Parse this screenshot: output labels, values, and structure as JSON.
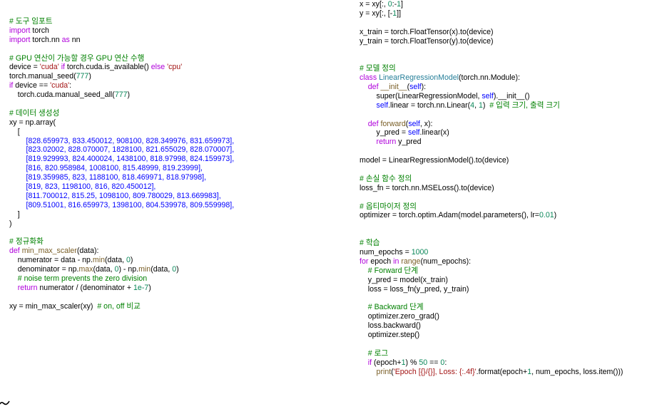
{
  "colors": {
    "keyword": "#af00db",
    "comment": "#008000",
    "string": "#a31515",
    "number": "#098658",
    "function": "#795e26",
    "class": "#267f99",
    "self": "#0000ff",
    "list": "#0000ff",
    "text": "#000000",
    "background": "#ffffff"
  },
  "left_code": [
    [
      [
        "cm",
        "# 도구 임포트"
      ]
    ],
    [
      [
        "kw",
        "import"
      ],
      [
        "tx",
        " torch"
      ]
    ],
    [
      [
        "kw",
        "import"
      ],
      [
        "tx",
        " torch.nn "
      ],
      [
        "kw",
        "as"
      ],
      [
        "tx",
        " nn"
      ]
    ],
    [],
    [
      [
        "cm",
        "# GPU 연산이 가능할 경우 GPU 연산 수행"
      ]
    ],
    [
      [
        "tx",
        "device = "
      ],
      [
        "st",
        "'cuda'"
      ],
      [
        "tx",
        " "
      ],
      [
        "kw",
        "if"
      ],
      [
        "tx",
        " torch.cuda.is_available() "
      ],
      [
        "kw",
        "else"
      ],
      [
        "tx",
        " "
      ],
      [
        "st",
        "'cpu'"
      ]
    ],
    [
      [
        "tx",
        "torch.manual_seed("
      ],
      [
        "nu",
        "777"
      ],
      [
        "tx",
        ")"
      ]
    ],
    [
      [
        "kw",
        "if"
      ],
      [
        "tx",
        " device == "
      ],
      [
        "st",
        "'cuda'"
      ],
      [
        "tx",
        ":"
      ]
    ],
    [
      [
        "tx",
        "    torch.cuda.manual_seed_all("
      ],
      [
        "nu",
        "777"
      ],
      [
        "tx",
        ")"
      ]
    ],
    [],
    [
      [
        "cm",
        "# 데이터 생성성"
      ]
    ],
    [
      [
        "tx",
        "xy = np.array("
      ]
    ],
    [
      [
        "tx",
        "    ["
      ]
    ],
    [
      [
        "tx",
        "        "
      ],
      [
        "bl",
        "[828.659973, 833.450012, 908100, 828.349976, 831.659973],"
      ]
    ],
    [
      [
        "tx",
        "        "
      ],
      [
        "bl",
        "[823.02002, 828.070007, 1828100, 821.655029, 828.070007],"
      ]
    ],
    [
      [
        "tx",
        "        "
      ],
      [
        "bl",
        "[819.929993, 824.400024, 1438100, 818.97998, 824.159973],"
      ]
    ],
    [
      [
        "tx",
        "        "
      ],
      [
        "bl",
        "[816, 820.958984, 1008100, 815.48999, 819.23999],"
      ]
    ],
    [
      [
        "tx",
        "        "
      ],
      [
        "bl",
        "[819.359985, 823, 1188100, 818.469971, 818.97998],"
      ]
    ],
    [
      [
        "tx",
        "        "
      ],
      [
        "bl",
        "[819, 823, 1198100, 816, 820.450012],"
      ]
    ],
    [
      [
        "tx",
        "        "
      ],
      [
        "bl",
        "[811.700012, 815.25, 1098100, 809.780029, 813.669983],"
      ]
    ],
    [
      [
        "tx",
        "        "
      ],
      [
        "bl",
        "[809.51001, 816.659973, 1398100, 804.539978, 809.559998],"
      ]
    ],
    [
      [
        "tx",
        "    ]"
      ]
    ],
    [
      [
        "tx",
        ")"
      ]
    ],
    [],
    [
      [
        "cm",
        "# 정규화화"
      ]
    ],
    [
      [
        "kw",
        "def"
      ],
      [
        "tx",
        " "
      ],
      [
        "fn",
        "min_max_scaler"
      ],
      [
        "tx",
        "(data):"
      ]
    ],
    [
      [
        "tx",
        "    numerator = data - np."
      ],
      [
        "fn",
        "min"
      ],
      [
        "tx",
        "(data, "
      ],
      [
        "nu",
        "0"
      ],
      [
        "tx",
        ")"
      ]
    ],
    [
      [
        "tx",
        "    denominator = np."
      ],
      [
        "fn",
        "max"
      ],
      [
        "tx",
        "(data, "
      ],
      [
        "nu",
        "0"
      ],
      [
        "tx",
        ") - np."
      ],
      [
        "fn",
        "min"
      ],
      [
        "tx",
        "(data, "
      ],
      [
        "nu",
        "0"
      ],
      [
        "tx",
        ")"
      ]
    ],
    [
      [
        "tx",
        "    "
      ],
      [
        "cm",
        "# noise term prevents the zero division"
      ]
    ],
    [
      [
        "tx",
        "    "
      ],
      [
        "kw",
        "return"
      ],
      [
        "tx",
        " numerator / (denominator + "
      ],
      [
        "nu",
        "1e-7"
      ],
      [
        "tx",
        ")"
      ]
    ],
    [],
    [
      [
        "tx",
        "xy = min_max_scaler(xy)  "
      ],
      [
        "cm",
        "# on, off 비교"
      ]
    ]
  ],
  "right_code": [
    [
      [
        "tx",
        "x = xy[:, "
      ],
      [
        "nu",
        "0"
      ],
      [
        "tx",
        ":-"
      ],
      [
        "nu",
        "1"
      ],
      [
        "tx",
        "]"
      ]
    ],
    [
      [
        "tx",
        "y = xy[:, [-"
      ],
      [
        "nu",
        "1"
      ],
      [
        "tx",
        "]]"
      ]
    ],
    [],
    [
      [
        "tx",
        "x_train = torch.FloatTensor(x).to(device)"
      ]
    ],
    [
      [
        "tx",
        "y_train = torch.FloatTensor(y).to(device)"
      ]
    ],
    [],
    [],
    [
      [
        "cm",
        "# 모델 정의"
      ]
    ],
    [
      [
        "kw",
        "class"
      ],
      [
        "tx",
        " "
      ],
      [
        "cl",
        "LinearRegressionModel"
      ],
      [
        "tx",
        "(torch.nn.Module):"
      ]
    ],
    [
      [
        "tx",
        "    "
      ],
      [
        "kw",
        "def"
      ],
      [
        "tx",
        " "
      ],
      [
        "fn",
        "__init__"
      ],
      [
        "tx",
        "("
      ],
      [
        "sf",
        "self"
      ],
      [
        "tx",
        "):"
      ]
    ],
    [
      [
        "tx",
        "        super(LinearRegressionModel, "
      ],
      [
        "sf",
        "self"
      ],
      [
        "tx",
        ").__init__()"
      ]
    ],
    [
      [
        "tx",
        "        "
      ],
      [
        "sf",
        "self"
      ],
      [
        "tx",
        ".linear = torch.nn.Linear("
      ],
      [
        "nu",
        "4"
      ],
      [
        "tx",
        ", "
      ],
      [
        "nu",
        "1"
      ],
      [
        "tx",
        ")  "
      ],
      [
        "cm",
        "# 입력 크기, 출력 크기"
      ]
    ],
    [],
    [
      [
        "tx",
        "    "
      ],
      [
        "kw",
        "def"
      ],
      [
        "tx",
        " "
      ],
      [
        "fn",
        "forward"
      ],
      [
        "tx",
        "("
      ],
      [
        "sf",
        "self"
      ],
      [
        "tx",
        ", x):"
      ]
    ],
    [
      [
        "tx",
        "        y_pred = "
      ],
      [
        "sf",
        "self"
      ],
      [
        "tx",
        ".linear(x)"
      ]
    ],
    [
      [
        "tx",
        "        "
      ],
      [
        "kw",
        "return"
      ],
      [
        "tx",
        " y_pred"
      ]
    ],
    [],
    [
      [
        "tx",
        "model = LinearRegressionModel().to(device)"
      ]
    ],
    [],
    [
      [
        "cm",
        "# 손실 함수 정의"
      ]
    ],
    [
      [
        "tx",
        "loss_fn = torch.nn.MSELoss().to(device)"
      ]
    ],
    [],
    [
      [
        "cm",
        "# 옵티마이저 정의"
      ]
    ],
    [
      [
        "tx",
        "optimizer = torch.optim.Adam(model.parameters(), lr="
      ],
      [
        "nu",
        "0.01"
      ],
      [
        "tx",
        ")"
      ]
    ],
    [],
    [],
    [
      [
        "cm",
        "# 학습"
      ]
    ],
    [
      [
        "tx",
        "num_epochs = "
      ],
      [
        "nu",
        "1000"
      ]
    ],
    [
      [
        "kw",
        "for"
      ],
      [
        "tx",
        " epoch "
      ],
      [
        "kw",
        "in"
      ],
      [
        "tx",
        " "
      ],
      [
        "fn",
        "range"
      ],
      [
        "tx",
        "(num_epochs):"
      ]
    ],
    [
      [
        "tx",
        "    "
      ],
      [
        "cm",
        "# Forward 단계"
      ]
    ],
    [
      [
        "tx",
        "    y_pred = model(x_train)"
      ]
    ],
    [
      [
        "tx",
        "    loss = loss_fn(y_pred, y_train)"
      ]
    ],
    [],
    [
      [
        "tx",
        "    "
      ],
      [
        "cm",
        "# Backward 단계"
      ]
    ],
    [
      [
        "tx",
        "    optimizer.zero_grad()"
      ]
    ],
    [
      [
        "tx",
        "    loss.backward()"
      ]
    ],
    [
      [
        "tx",
        "    optimizer.step()"
      ]
    ],
    [],
    [
      [
        "tx",
        "    "
      ],
      [
        "cm",
        "# 로그"
      ]
    ],
    [
      [
        "tx",
        "    "
      ],
      [
        "kw",
        "if"
      ],
      [
        "tx",
        " (epoch+"
      ],
      [
        "nu",
        "1"
      ],
      [
        "tx",
        ") % "
      ],
      [
        "nu",
        "50"
      ],
      [
        "tx",
        " == "
      ],
      [
        "nu",
        "0"
      ],
      [
        "tx",
        ":"
      ]
    ],
    [
      [
        "tx",
        "        "
      ],
      [
        "fn",
        "print"
      ],
      [
        "tx",
        "("
      ],
      [
        "st",
        "'Epoch [{}/{}], Loss: {:.4f}'"
      ],
      [
        "tx",
        ".format(epoch+"
      ],
      [
        "nu",
        "1"
      ],
      [
        "tx",
        ", num_epochs, loss.item()))"
      ]
    ]
  ]
}
